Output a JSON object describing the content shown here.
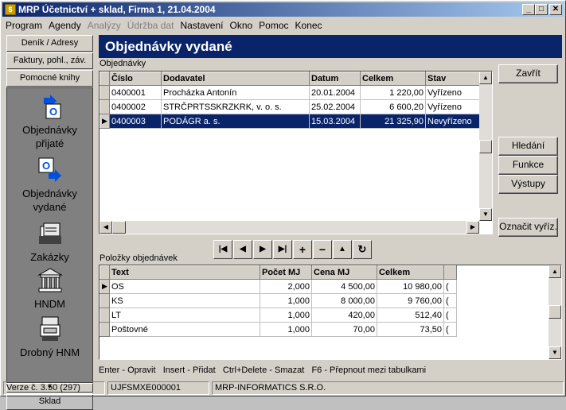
{
  "window": {
    "title": "MRP Účetnictví + sklad, Firma 1, 21.04.2004"
  },
  "menu": [
    "Program",
    "Agendy",
    "Analýzy",
    "Údržba dat",
    "Nastavení",
    "Okno",
    "Pomoc",
    "Konec"
  ],
  "sidebar": {
    "tabs": [
      "Deník / Adresy",
      "Faktury, pohl., záv.",
      "Pomocné knihy"
    ],
    "items": [
      {
        "label1": "Objednávky",
        "label2": "přijaté",
        "icon": "order-received-icon"
      },
      {
        "label1": "Objednávky",
        "label2": "vydané",
        "icon": "order-issued-icon"
      },
      {
        "label1": "Zakázky",
        "label2": "",
        "icon": "contracts-icon"
      },
      {
        "label1": "HNDM",
        "label2": "",
        "icon": "building-icon"
      },
      {
        "label1": "Drobný HNM",
        "label2": "",
        "icon": "tools-icon"
      }
    ],
    "bottom_tab": "Sklad"
  },
  "header": {
    "title": "Objednávky vydané"
  },
  "orders": {
    "label": "Objednávky",
    "columns": [
      "Číslo",
      "Dodavatel",
      "Datum",
      "Celkem",
      "Stav"
    ],
    "rows": [
      [
        "0400001",
        "Procházka Antonín",
        "20.01.2004",
        "1 220,00",
        "Vyřízeno"
      ],
      [
        "0400002",
        "STRČPRTSSKRZKRK, v. o. s.",
        "25.02.2004",
        "6 600,20",
        "Vyřízeno"
      ],
      [
        "0400003",
        "PODÁGR a. s.",
        "15.03.2004",
        "21 325,90",
        "Nevyřízeno"
      ]
    ]
  },
  "buttons": {
    "close": "Zavřít",
    "search": "Hledání",
    "functions": "Funkce",
    "outputs": "Výstupy",
    "mark_done": "Označit vyříz."
  },
  "items": {
    "label": "Položky objednávek",
    "columns": [
      "Text",
      "Počet MJ",
      "Cena MJ",
      "Celkem"
    ],
    "rows": [
      [
        "OS",
        "2,000",
        "4 500,00",
        "10 980,00",
        "("
      ],
      [
        "KS",
        "1,000",
        "8 000,00",
        "9 760,00",
        "("
      ],
      [
        "LT",
        "1,000",
        "420,00",
        "512,40",
        "("
      ],
      [
        "Poštovné",
        "1,000",
        "70,00",
        "73,50",
        "("
      ]
    ]
  },
  "hint": "Enter - Opravit   Insert - Přidat   Ctrl+Delete - Smazat   F6 - Přepnout mezi tabulkami",
  "status": {
    "version": "Verze č. 3.50 (297)",
    "code": "UJFSMXE000001",
    "company": "MRP-INFORMATICS S.R.O."
  }
}
